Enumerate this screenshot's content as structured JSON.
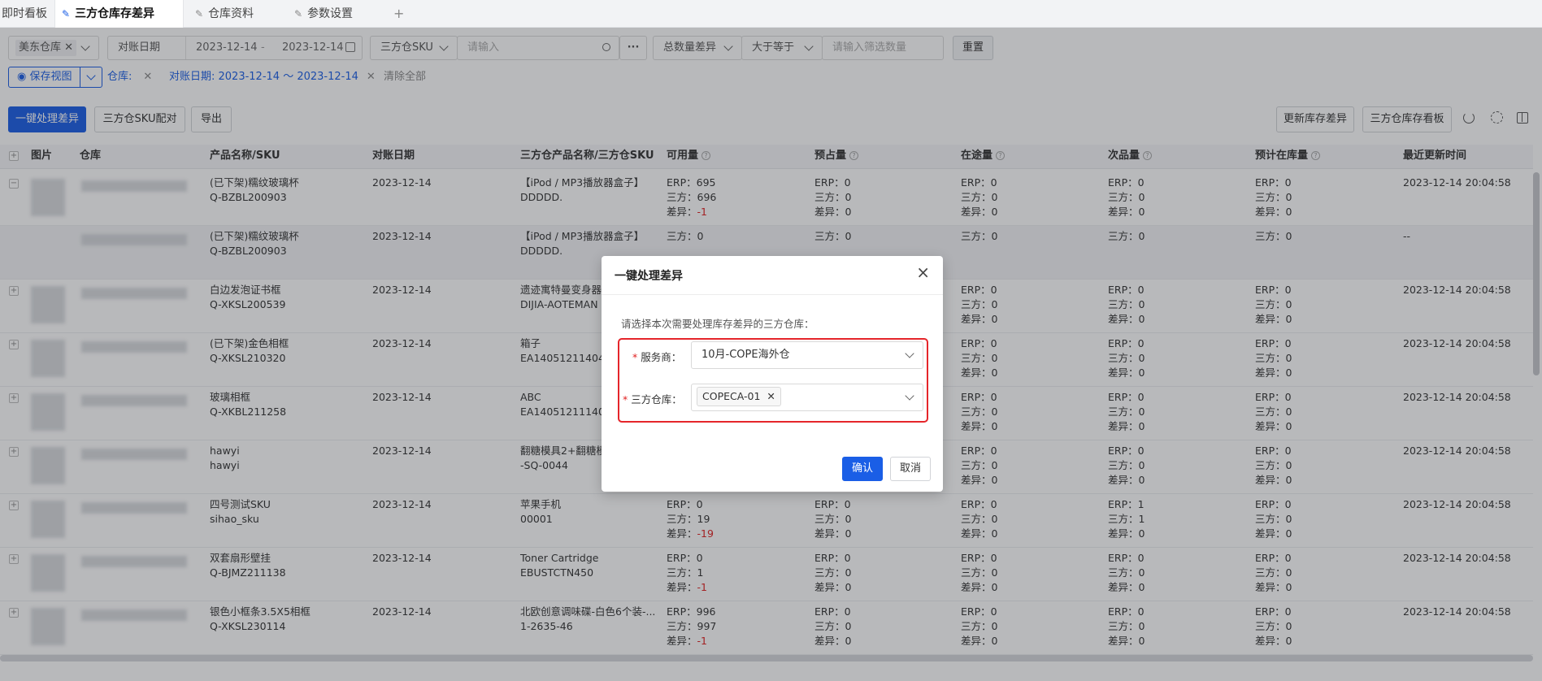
{
  "tabs": [
    {
      "label": "即时看板",
      "pinned": false,
      "active": false
    },
    {
      "label": "三方仓库存差异",
      "pinned": true,
      "active": true
    },
    {
      "label": "仓库资料",
      "pinned": true,
      "active": false
    },
    {
      "label": "参数设置",
      "pinned": true,
      "active": false
    }
  ],
  "tab_add": "+",
  "filters": {
    "warehouse_tag": "美东仓库",
    "date_label": "对账日期",
    "date_start": "2023-12-14",
    "date_sep": "-",
    "date_end": "2023-12-14",
    "sku_type": "三方仓SKU",
    "sku_placeholder": "请输入",
    "more": "···",
    "diff_field": "总数量差异",
    "diff_op": "大于等于",
    "diff_placeholder": "请输入筛选数量",
    "reset": "重置"
  },
  "view": {
    "save_view": "保存视图",
    "chip_warehouse": "仓库:",
    "chip_date": "对账日期:  2023-12-14 ～ 2023-12-14",
    "clear_all": "清除全部"
  },
  "toolbar": {
    "process": "一键处理差异",
    "pair": "三方仓SKU配对",
    "export": "导出",
    "update_diff": "更新库存差异",
    "dashboard": "三方仓库存看板"
  },
  "columns": [
    "图片",
    "仓库",
    "产品名称/SKU",
    "对账日期",
    "三方仓产品名称/三方仓SKU",
    "可用量",
    "预占量",
    "在途量",
    "次品量",
    "预计在库量",
    "最近更新时间"
  ],
  "rows": [
    {
      "name": "(已下架)糯纹玻璃杯",
      "sku": "Q-BZBL200903",
      "date": "2023-12-14",
      "tp_name": "【iPod / MP3播放器盒子】",
      "tp_sku": "DDDDD.",
      "avail": [
        "ERP：695",
        "三方：696",
        "差异：-1"
      ],
      "avail_red": true,
      "pre": [
        "ERP：0",
        "三方：0",
        "差异：0"
      ],
      "transit": [
        "ERP：0",
        "三方：0",
        "差异：0"
      ],
      "defect": [
        "ERP：0",
        "三方：0",
        "差异：0"
      ],
      "expected": [
        "ERP：0",
        "三方：0",
        "差异：0"
      ],
      "updated": "2023-12-14 20:04:58"
    },
    {
      "name": "(已下架)糯纹玻璃杯",
      "sku": "Q-BZBL200903",
      "date": "2023-12-14",
      "tp_name": "【iPod / MP3播放器盒子】",
      "tp_sku": "DDDDD.",
      "avail": [
        "三方：0"
      ],
      "avail_red": false,
      "pre": [
        "三方：0"
      ],
      "transit": [
        "三方：0"
      ],
      "defect": [
        "三方：0"
      ],
      "expected": [
        "三方：0"
      ],
      "updated": "--"
    },
    {
      "name": "白边发泡证书框",
      "sku": "Q-XKSL200539",
      "date": "2023-12-14",
      "tp_name": "遗迹寓特曼变身器",
      "tp_sku": "DIJIA-AOTEMAN",
      "avail": [],
      "avail_red": false,
      "pre": [],
      "transit": [
        "ERP：0",
        "三方：0",
        "差异：0"
      ],
      "defect": [
        "ERP：0",
        "三方：0",
        "差异：0"
      ],
      "expected": [
        "ERP：0",
        "三方：0",
        "差异：0"
      ],
      "updated": "2023-12-14 20:04:58"
    },
    {
      "name": "(已下架)金色相框",
      "sku": "Q-XKSL210320",
      "date": "2023-12-14",
      "tp_name": "箱子",
      "tp_sku": "EA14051211404",
      "avail": [],
      "avail_red": false,
      "pre": [],
      "transit": [
        "ERP：0",
        "三方：0",
        "差异：0"
      ],
      "defect": [
        "ERP：0",
        "三方：0",
        "差异：0"
      ],
      "expected": [
        "ERP：0",
        "三方：0",
        "差异：0"
      ],
      "updated": "2023-12-14 20:04:58"
    },
    {
      "name": "玻璃相框",
      "sku": "Q-XKBL211258",
      "date": "2023-12-14",
      "tp_name": "ABC",
      "tp_sku": "EA14051211140U",
      "avail": [],
      "avail_red": false,
      "pre": [],
      "transit": [
        "ERP：0",
        "三方：0",
        "差异：0"
      ],
      "defect": [
        "ERP：0",
        "三方：0",
        "差异：0"
      ],
      "expected": [
        "ERP：0",
        "三方：0",
        "差异：0"
      ],
      "updated": "2023-12-14 20:04:58"
    },
    {
      "name": "hawyi",
      "sku": "hawyi",
      "date": "2023-12-14",
      "tp_name": "翻糖模具2+翻糖模",
      "tp_sku": "-SQ-0044",
      "avail": [],
      "avail_red": false,
      "pre": [],
      "transit": [
        "ERP：0",
        "三方：0",
        "差异：0"
      ],
      "defect": [
        "ERP：0",
        "三方：0",
        "差异：0"
      ],
      "expected": [
        "ERP：0",
        "三方：0",
        "差异：0"
      ],
      "updated": "2023-12-14 20:04:58"
    },
    {
      "name": "四号测试SKU",
      "sku": "sihao_sku",
      "date": "2023-12-14",
      "tp_name": "苹果手机",
      "tp_sku": "00001",
      "avail": [
        "ERP：0",
        "三方：19",
        "差异：-19"
      ],
      "avail_red": true,
      "pre": [
        "ERP：0",
        "三方：0",
        "差异：0"
      ],
      "transit": [
        "ERP：0",
        "三方：0",
        "差异：0"
      ],
      "defect": [
        "ERP：1",
        "三方：1",
        "差异：0"
      ],
      "expected": [
        "ERP：0",
        "三方：0",
        "差异：0"
      ],
      "updated": "2023-12-14 20:04:58"
    },
    {
      "name": "双套扇形壁挂",
      "sku": "Q-BJMZ211138",
      "date": "2023-12-14",
      "tp_name": "Toner Cartridge",
      "tp_sku": "EBUSTCTN450",
      "avail": [
        "ERP：0",
        "三方：1",
        "差异：-1"
      ],
      "avail_red": true,
      "pre": [
        "ERP：0",
        "三方：0",
        "差异：0"
      ],
      "transit": [
        "ERP：0",
        "三方：0",
        "差异：0"
      ],
      "defect": [
        "ERP：0",
        "三方：0",
        "差异：0"
      ],
      "expected": [
        "ERP：0",
        "三方：0",
        "差异：0"
      ],
      "updated": "2023-12-14 20:04:58"
    },
    {
      "name": "银色小框条3.5X5相框",
      "sku": "Q-XKSL230114",
      "date": "2023-12-14",
      "tp_name": "北欧创意调味碟-白色6个装-...",
      "tp_sku": "1-2635-46",
      "avail": [
        "ERP：996",
        "三方：997",
        "差异：-1"
      ],
      "avail_red": true,
      "pre": [
        "ERP：0",
        "三方：0",
        "差异：0"
      ],
      "transit": [
        "ERP：0",
        "三方：0",
        "差异：0"
      ],
      "defect": [
        "ERP：0",
        "三方：0",
        "差异：0"
      ],
      "expected": [
        "ERP：0",
        "三方：0",
        "差异：0"
      ],
      "updated": "2023-12-14 20:04:58"
    }
  ],
  "modal": {
    "title": "一键处理差异",
    "close": "×",
    "hint": "请选择本次需要处理库存差异的三方仓库：",
    "provider_label": "服务商：",
    "provider_value": "10月-COPE海外仓",
    "warehouse_label": "三方仓库：",
    "warehouse_tag": "COPECA-01",
    "required": "*",
    "confirm": "确认",
    "cancel": "取消"
  },
  "colors": {
    "primary": "#1a5ee6",
    "danger": "#e02020",
    "highlight": "#e5252a"
  }
}
